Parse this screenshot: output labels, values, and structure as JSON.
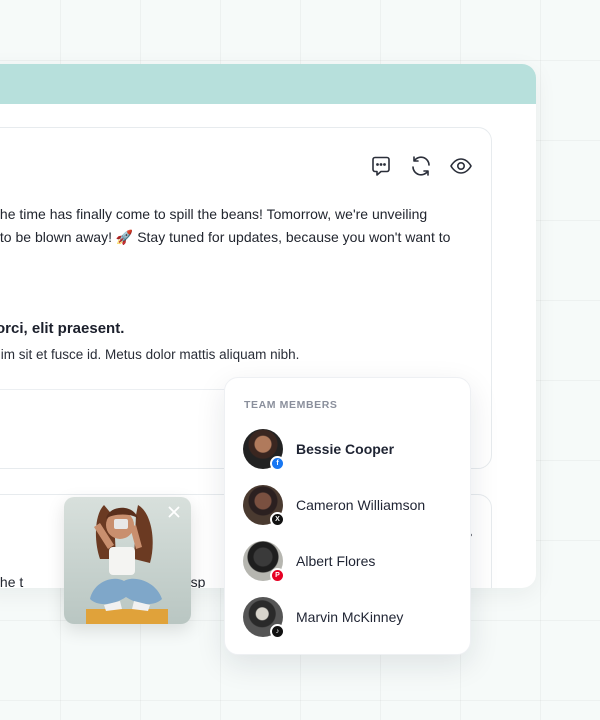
{
  "post_one": {
    "line1": ", and the time has finally come to spill the beans! Tomorrow, we're unveiling",
    "line2": "ready to be blown away! 🚀 Stay tuned for updates, because you won't want to",
    "heading": "ibus orci, elit praesent.",
    "subtext": "stie enim sit et fusce id. Metus dolor mattis aliquam nibh.",
    "button_label": "✓"
  },
  "post_two": {
    "line1_left": ", and the t",
    "line1_right": "to sp"
  },
  "icons": {
    "comment": "comment-icon",
    "refresh": "refresh-icon",
    "preview": "eye-icon",
    "close": "close-icon"
  },
  "team": {
    "title": "TEAM MEMBERS",
    "members": [
      {
        "name": "Bessie Cooper",
        "network": "facebook",
        "badge_color": "#1877f2",
        "selected": true
      },
      {
        "name": "Cameron Williamson",
        "network": "x",
        "badge_color": "#111111",
        "selected": false
      },
      {
        "name": "Albert Flores",
        "network": "pinterest",
        "badge_color": "#e60023",
        "selected": false
      },
      {
        "name": "Marvin McKinney",
        "network": "tiktok",
        "badge_color": "#111111",
        "selected": false
      }
    ]
  },
  "colors": {
    "accent": "#2aa39a",
    "header_band": "#b7e0dc"
  }
}
